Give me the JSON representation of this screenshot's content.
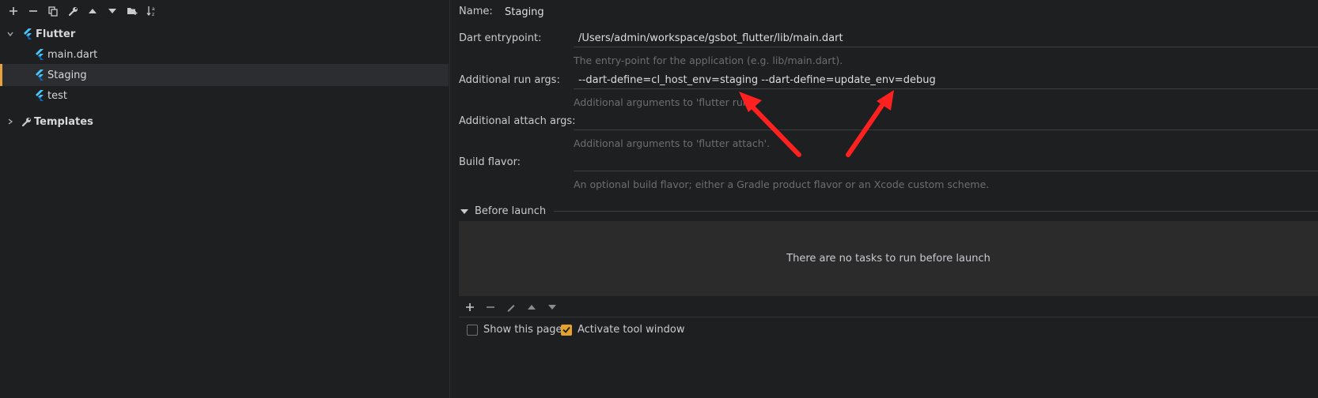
{
  "toolbar": {
    "icons": [
      "plus-icon",
      "minus-icon",
      "copy-icon",
      "wrench-icon",
      "up-icon",
      "down-icon",
      "folder-icon",
      "sort-icon"
    ]
  },
  "tree": {
    "flutter": {
      "label": "Flutter"
    },
    "children": [
      {
        "label": "main.dart"
      },
      {
        "label": "Staging"
      },
      {
        "label": "test"
      }
    ],
    "templates": {
      "label": "Templates"
    }
  },
  "form": {
    "name": {
      "label": "Name:",
      "value": "Staging"
    },
    "entrypoint": {
      "label": "Dart entrypoint:",
      "value": "/Users/admin/workspace/gsbot_flutter/lib/main.dart",
      "hint": "The entry-point for the application (e.g. lib/main.dart)."
    },
    "run_args": {
      "label": "Additional run args:",
      "value": "--dart-define=cl_host_env=staging --dart-define=update_env=debug",
      "hint": "Additional arguments to 'flutter run'."
    },
    "attach_args": {
      "label": "Additional attach args:",
      "value": "",
      "hint": "Additional arguments to 'flutter attach'."
    },
    "build_flavor": {
      "label": "Build flavor:",
      "value": "",
      "hint": "An optional build flavor; either a Gradle product flavor or an Xcode custom scheme."
    }
  },
  "before_launch": {
    "title": "Before launch",
    "empty_text": "There are no tasks to run before launch"
  },
  "options": {
    "show_page": {
      "label": "Show this page",
      "checked": false
    },
    "activate_tool": {
      "label": "Activate tool window",
      "checked": true
    }
  },
  "colors": {
    "accent": "#e5a22b",
    "arrow": "#ff2020",
    "flutter_blue": "#47c5fb"
  }
}
